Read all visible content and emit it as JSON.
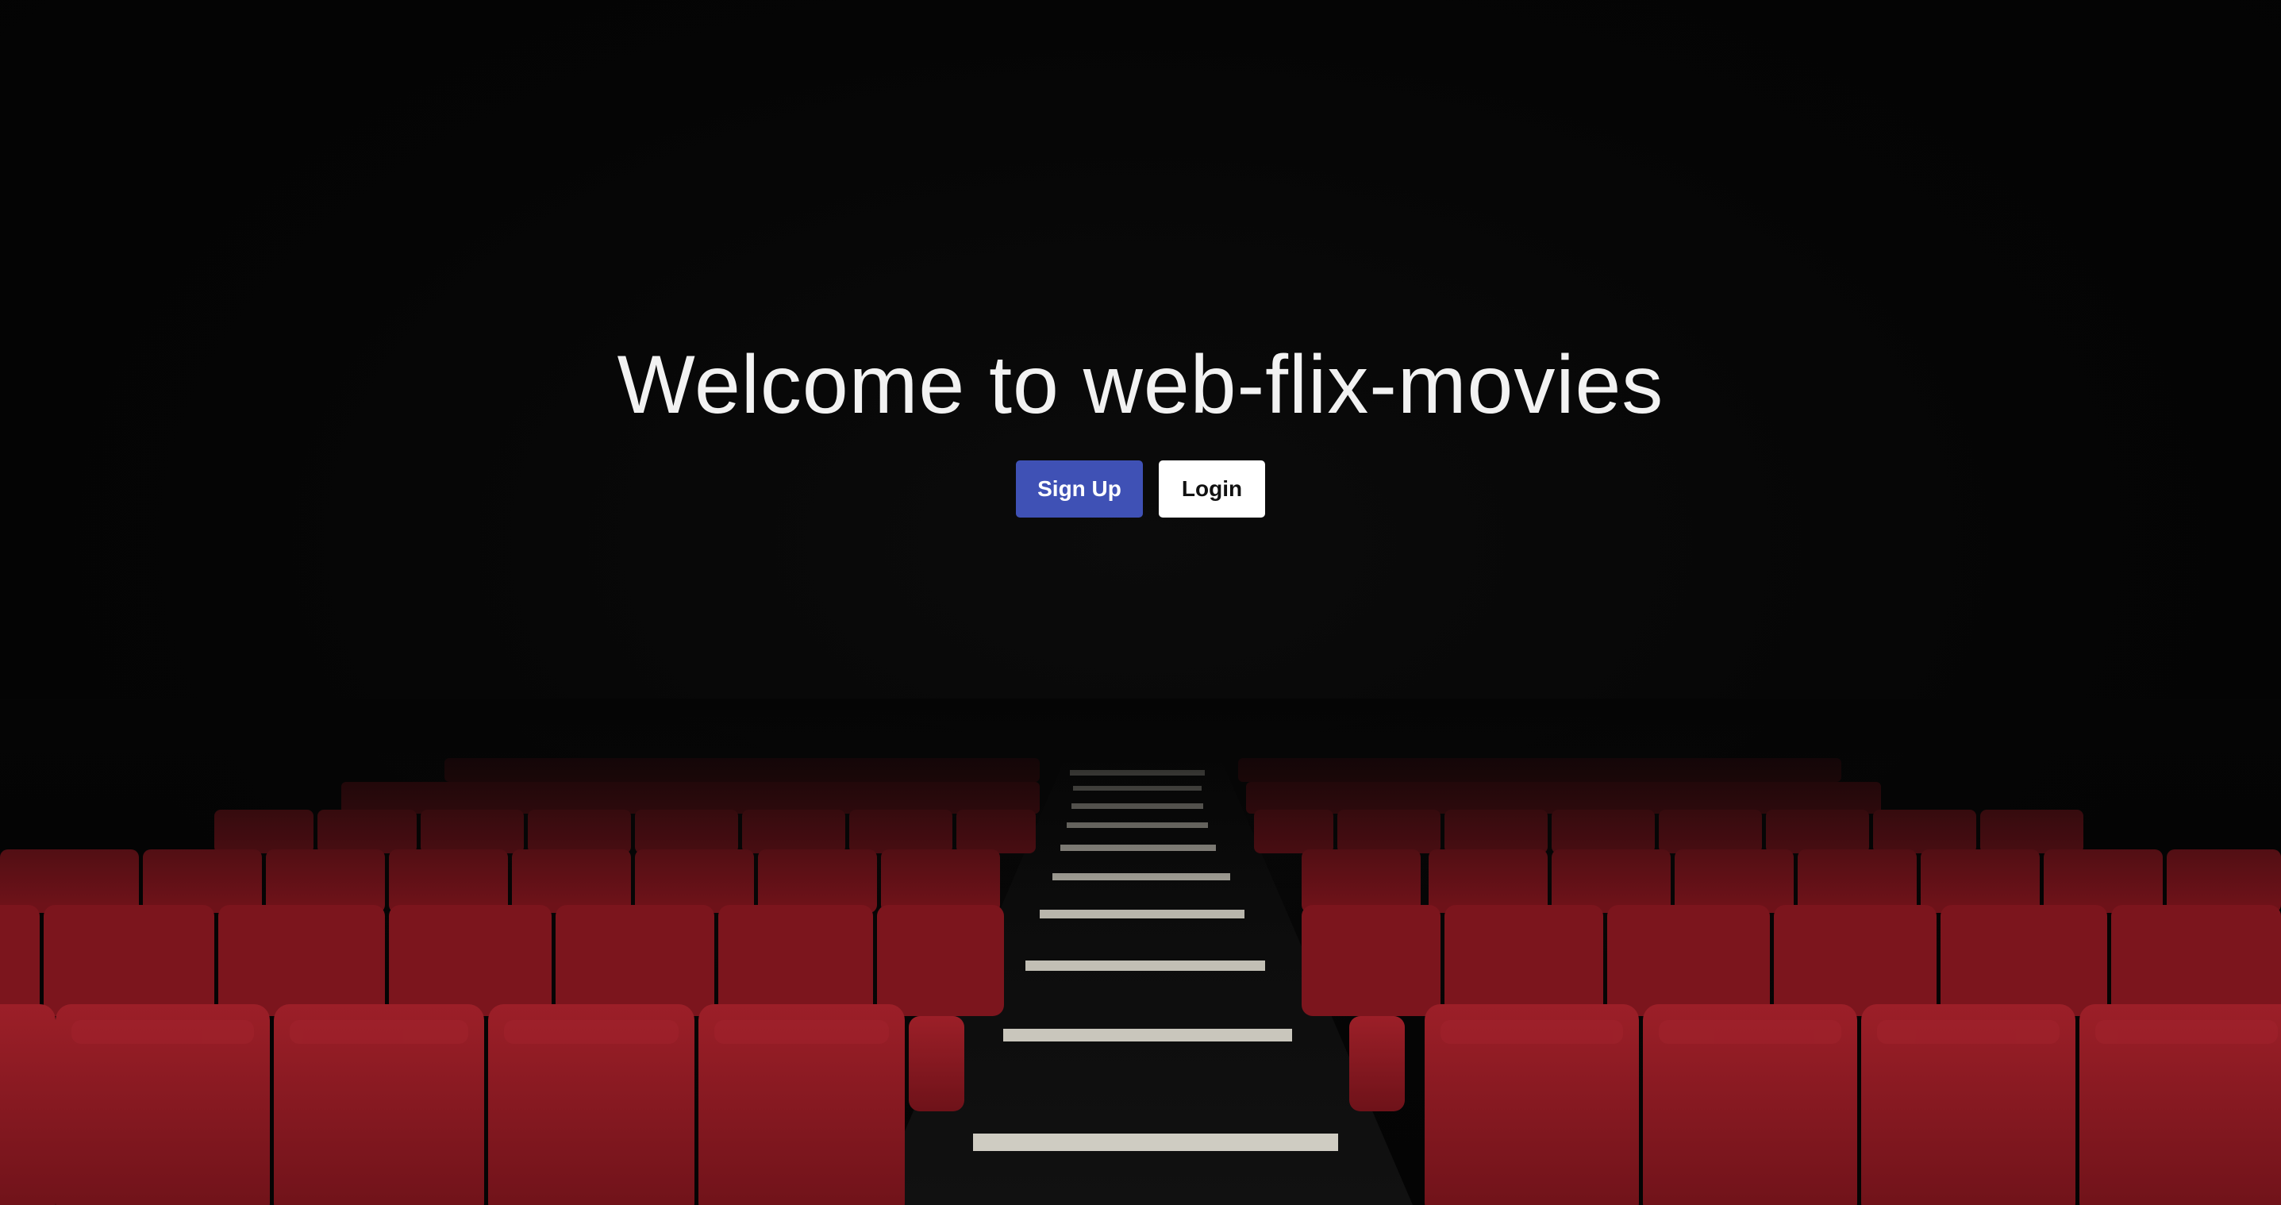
{
  "hero": {
    "title": "Welcome to web-flix-movies"
  },
  "actions": {
    "signup_label": "Sign Up",
    "login_label": "Login"
  },
  "colors": {
    "background": "#050505",
    "title_text": "#f2f2f2",
    "signup_button": "#3f51b5",
    "login_button": "#ffffff",
    "seat_red": "#8e1a22"
  },
  "background_image": {
    "icon": "cinema-seats-icon"
  }
}
